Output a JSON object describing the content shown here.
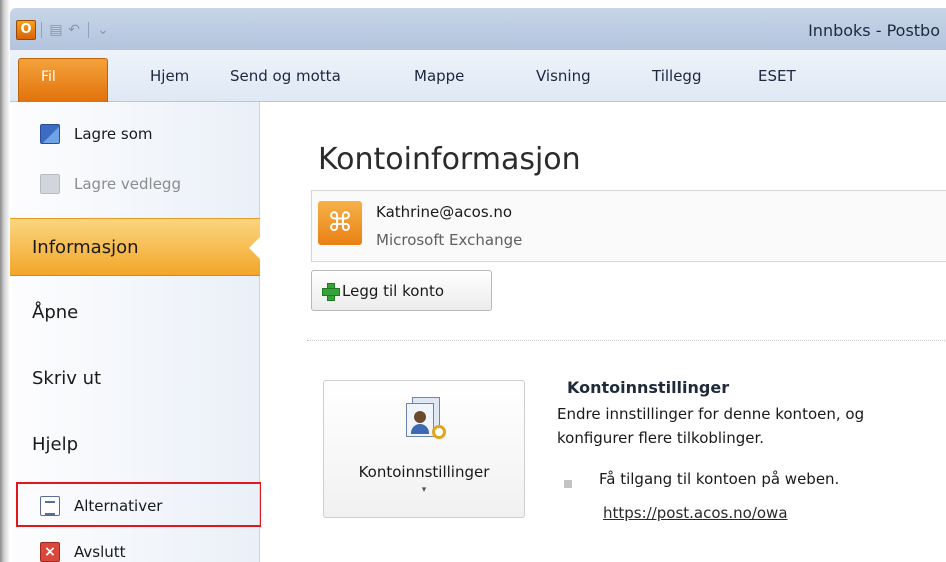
{
  "window": {
    "title": "Innboks - Postbo",
    "app_icon_letter": "O"
  },
  "quick_access": {
    "icons": [
      "send-receive-icon",
      "undo-icon",
      "customize-icon"
    ]
  },
  "ribbon": {
    "tabs": [
      {
        "label": "Fil"
      },
      {
        "label": "Hjem"
      },
      {
        "label": "Send og motta"
      },
      {
        "label": "Mappe"
      },
      {
        "label": "Visning"
      },
      {
        "label": "Tillegg"
      },
      {
        "label": "ESET"
      }
    ]
  },
  "backstage_nav": {
    "save_as": "Lagre som",
    "save_attachments": "Lagre vedlegg",
    "info": "Informasjon",
    "open": "Åpne",
    "print": "Skriv ut",
    "help": "Hjelp",
    "options": "Alternativer",
    "exit": "Avslutt"
  },
  "main": {
    "title": "Kontoinformasjon",
    "account": {
      "email": "Kathrine@acos.no",
      "type": "Microsoft Exchange"
    },
    "add_account_label": "Legg til konto",
    "account_settings": {
      "button_label": "Kontoinnstillinger",
      "caret": "▾",
      "heading": "Kontoinnstillinger",
      "description": "Endre innstillinger for denne kontoen, og konfigurer flere tilkoblinger.",
      "bullet_text": "Få tilgang til kontoen på weben.",
      "link": "https://post.acos.no/owa"
    }
  },
  "colors": {
    "file_tab": "#e2720b",
    "active_nav": "#f3a629",
    "highlight_box": "#e3161e"
  }
}
